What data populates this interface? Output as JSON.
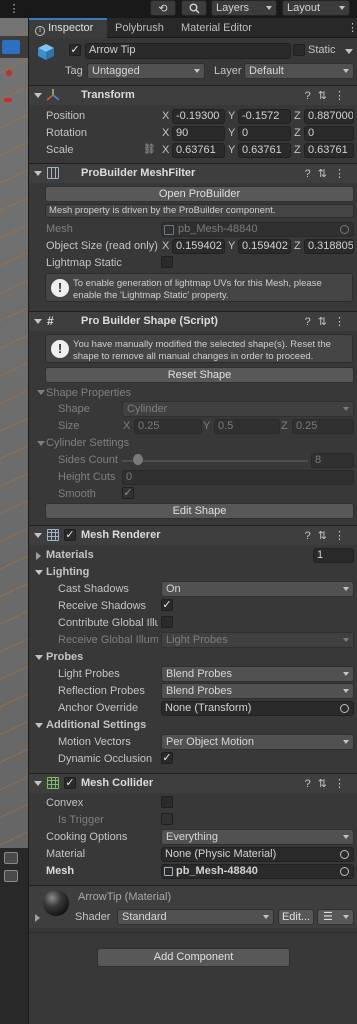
{
  "toolbar": {
    "undo_icon": "history-icon",
    "search_icon": "search-icon",
    "layers_label": "Layers",
    "layout_label": "Layout"
  },
  "tabs": [
    "Inspector",
    "Polybrush",
    "Material Editor"
  ],
  "object": {
    "name": "Arrow Tip",
    "static_label": "Static",
    "tag_label": "Tag",
    "tag_value": "Untagged",
    "layer_label": "Layer",
    "layer_value": "Default"
  },
  "transform": {
    "title": "Transform",
    "position_label": "Position",
    "rotation_label": "Rotation",
    "scale_label": "Scale",
    "axis": [
      "X",
      "Y",
      "Z"
    ],
    "position": [
      "-0.19300",
      "-0.1572",
      "0.887000"
    ],
    "rotation": [
      "90",
      "0",
      "0"
    ],
    "scale": [
      "0.63761",
      "0.63761",
      "0.63761"
    ]
  },
  "meshfilter": {
    "title": "ProBuilder MeshFilter",
    "open_button": "Open ProBuilder",
    "driven_note": "Mesh property is driven by the ProBuilder component.",
    "mesh_label": "Mesh",
    "mesh_value": "pb_Mesh-48840",
    "size_label": "Object Size (read only)",
    "size": [
      "0.159402",
      "0.159402",
      "0.318805"
    ],
    "lightmap_label": "Lightmap Static",
    "help_text": "To enable generation of lightmap UVs for this Mesh, please enable the 'Lightmap Static' property."
  },
  "shape": {
    "title": "Pro Builder Shape (Script)",
    "help_text": "You have manually modified the selected shape(s). Reset the shape to remove all manual changes in order to proceed.",
    "reset_button": "Reset Shape",
    "props_label": "Shape Properties",
    "shape_label": "Shape",
    "shape_value": "Cylinder",
    "size_label": "Size",
    "size": [
      "0.25",
      "0.5",
      "0.25"
    ],
    "cyl_label": "Cylinder Settings",
    "sides_label": "Sides Count",
    "sides_value": "8",
    "sides_slider_fraction": 0.06,
    "height_label": "Height Cuts",
    "height_value": "0",
    "smooth_label": "Smooth",
    "edit_button": "Edit Shape"
  },
  "renderer": {
    "title": "Mesh Renderer",
    "materials_label": "Materials",
    "materials_count": "1",
    "lighting_label": "Lighting",
    "cast_label": "Cast Shadows",
    "cast_value": "On",
    "receive_label": "Receive Shadows",
    "contrib_label": "Contribute Global Illu",
    "receive_gi_label": "Receive Global Illumi",
    "receive_gi_value": "Light Probes",
    "probes_label": "Probes",
    "light_probes_label": "Light Probes",
    "light_probes_value": "Blend Probes",
    "refl_label": "Reflection Probes",
    "refl_value": "Blend Probes",
    "anchor_label": "Anchor Override",
    "anchor_value": "None (Transform)",
    "additional_label": "Additional Settings",
    "motion_label": "Motion Vectors",
    "motion_value": "Per Object Motion",
    "occlusion_label": "Dynamic Occlusion"
  },
  "collider": {
    "title": "Mesh Collider",
    "convex_label": "Convex",
    "trigger_label": "Is Trigger",
    "cooking_label": "Cooking Options",
    "cooking_value": "Everything",
    "material_label": "Material",
    "material_value": "None (Physic Material)",
    "mesh_label": "Mesh",
    "mesh_value": "pb_Mesh-48840"
  },
  "material": {
    "name": "ArrowTip (Material)",
    "shader_label": "Shader",
    "shader_value": "Standard",
    "edit_button": "Edit...",
    "list_icon": "list-icon"
  },
  "add_component": "Add Component"
}
